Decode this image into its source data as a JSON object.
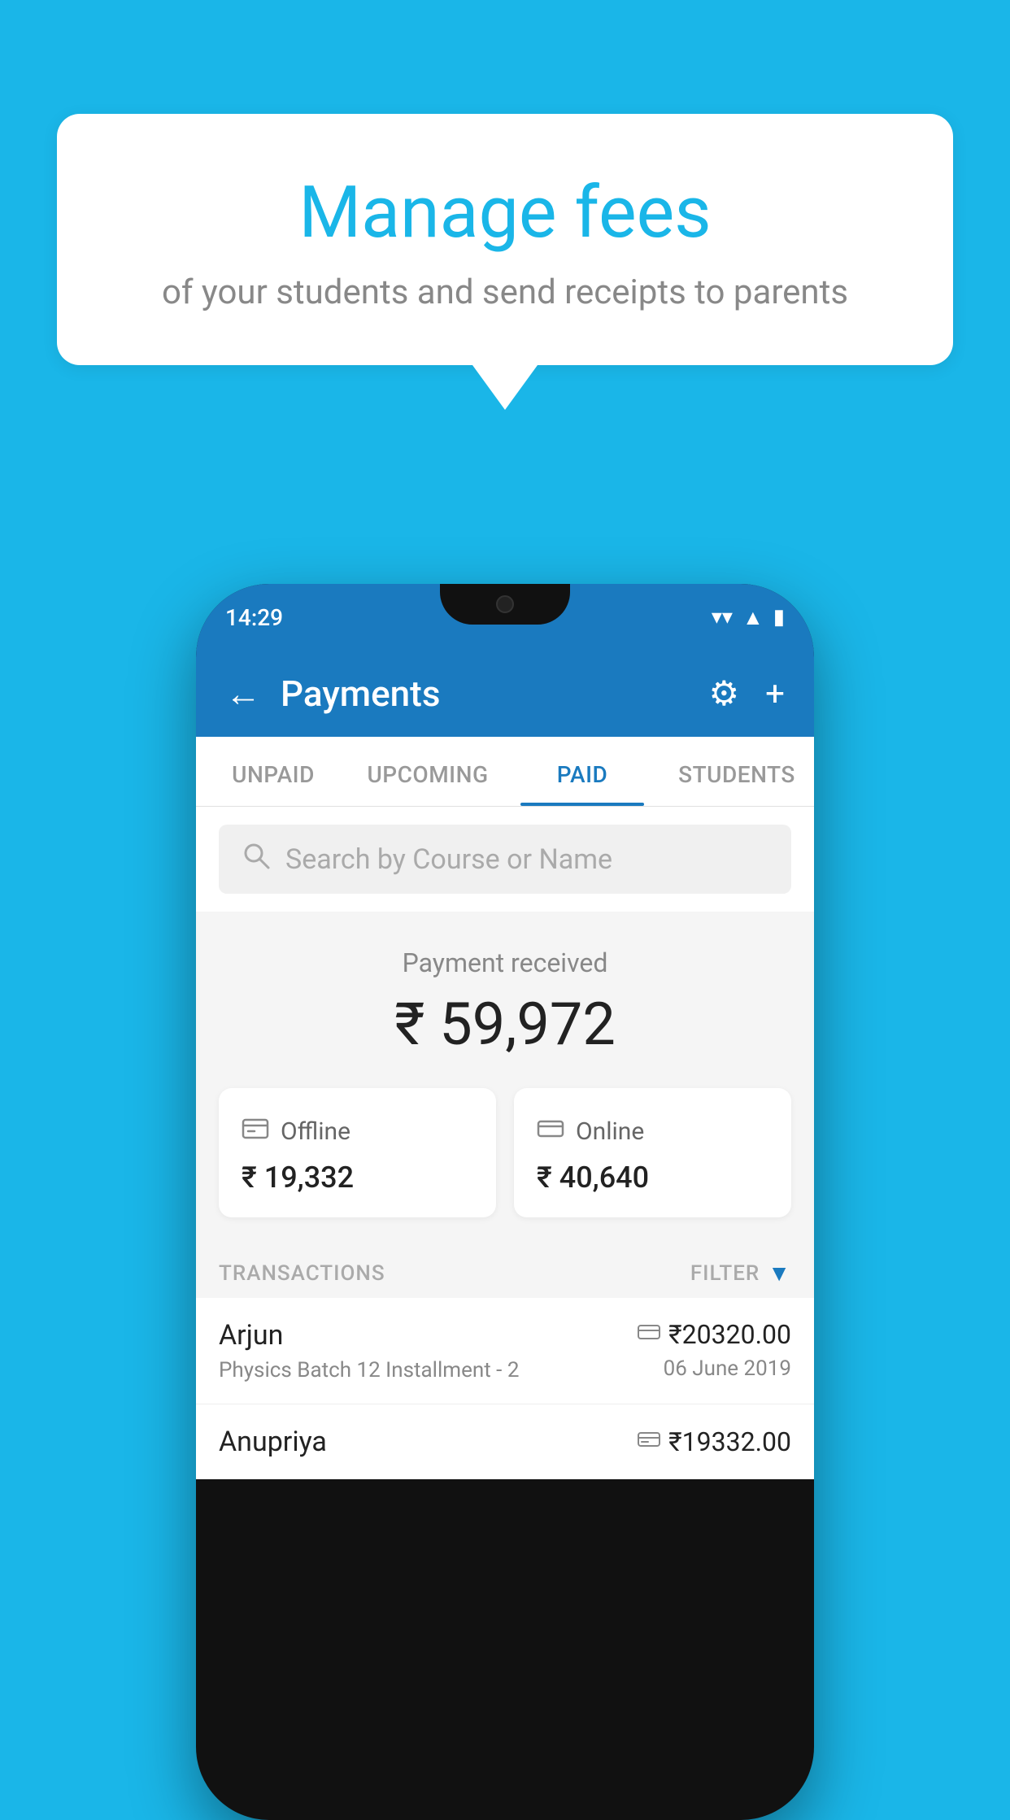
{
  "background": {
    "color": "#1ab6e8"
  },
  "speech_bubble": {
    "title": "Manage fees",
    "subtitle": "of your students and send receipts to parents"
  },
  "phone": {
    "status_bar": {
      "time": "14:29",
      "wifi": "▼",
      "signal": "▲",
      "battery": "▮"
    },
    "header": {
      "title": "Payments",
      "back_label": "←",
      "settings_label": "⚙",
      "add_label": "+"
    },
    "tabs": [
      {
        "label": "UNPAID",
        "active": false
      },
      {
        "label": "UPCOMING",
        "active": false
      },
      {
        "label": "PAID",
        "active": true
      },
      {
        "label": "STUDENTS",
        "active": false
      }
    ],
    "search": {
      "placeholder": "Search by Course or Name"
    },
    "payment_summary": {
      "label": "Payment received",
      "amount": "₹ 59,972"
    },
    "payment_cards": [
      {
        "icon": "offline",
        "label": "Offline",
        "amount": "₹ 19,332"
      },
      {
        "icon": "online",
        "label": "Online",
        "amount": "₹ 40,640"
      }
    ],
    "transactions": {
      "label": "TRANSACTIONS",
      "filter_label": "FILTER"
    },
    "transaction_rows": [
      {
        "name": "Arjun",
        "detail": "Physics Batch 12 Installment - 2",
        "amount": "₹20320.00",
        "date": "06 June 2019",
        "payment_type": "online"
      },
      {
        "name": "Anupriya",
        "detail": "",
        "amount": "₹19332.00",
        "date": "",
        "payment_type": "offline"
      }
    ]
  }
}
